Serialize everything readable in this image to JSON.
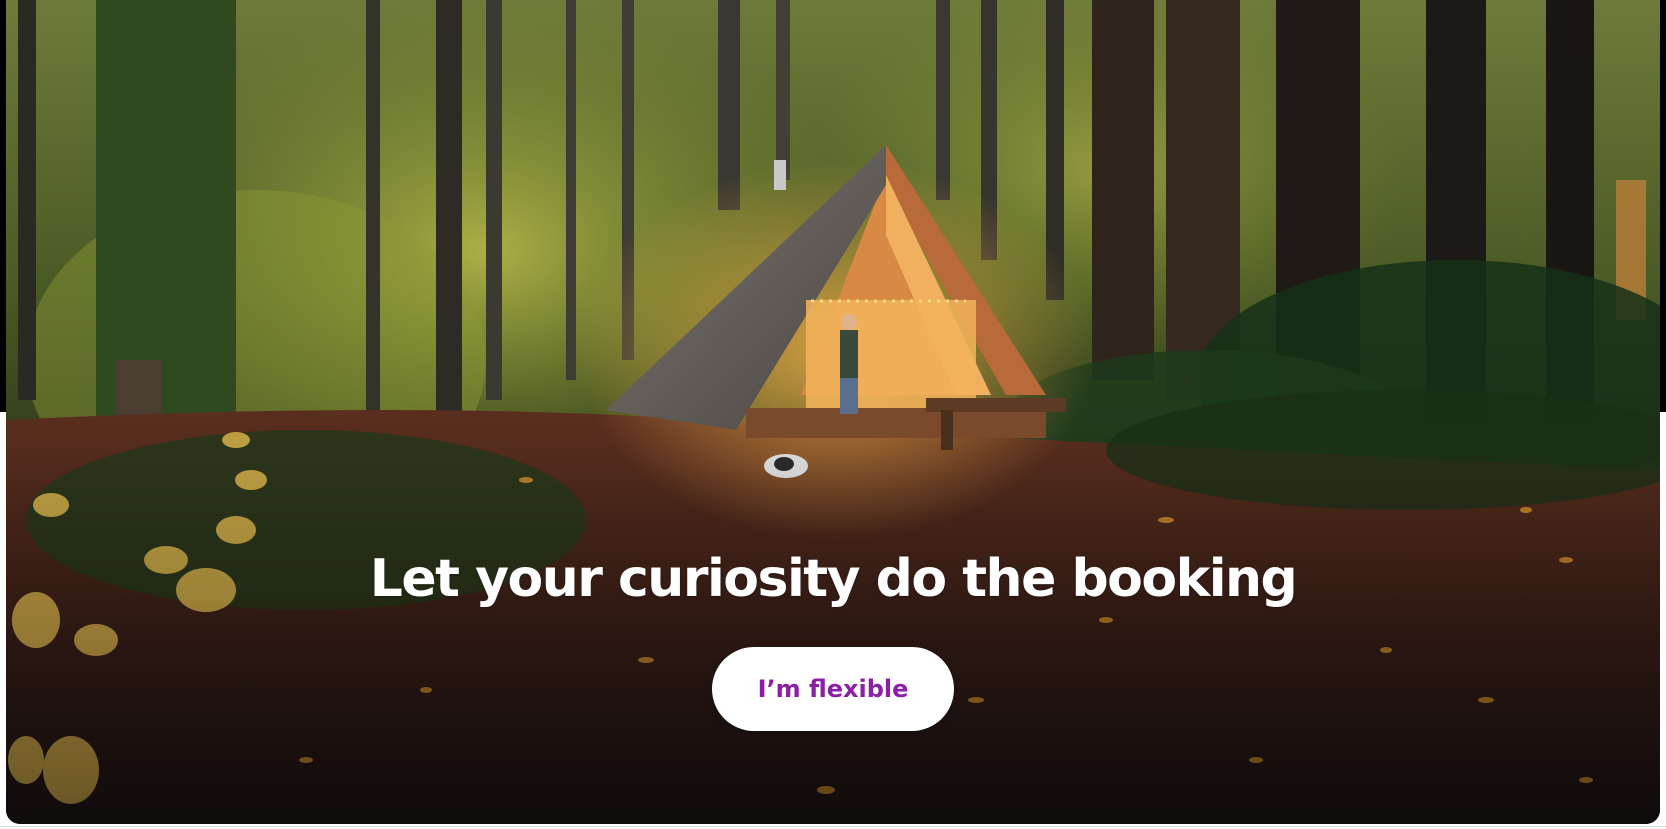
{
  "hero": {
    "headline": "Let your curiosity do the booking",
    "cta_label": "I’m flexible",
    "image_subject": "A-frame cabin in autumn forest at dusk"
  },
  "colors": {
    "cta_text": "#8b1fa8",
    "cta_background": "#ffffff",
    "headline_text": "#ffffff"
  }
}
